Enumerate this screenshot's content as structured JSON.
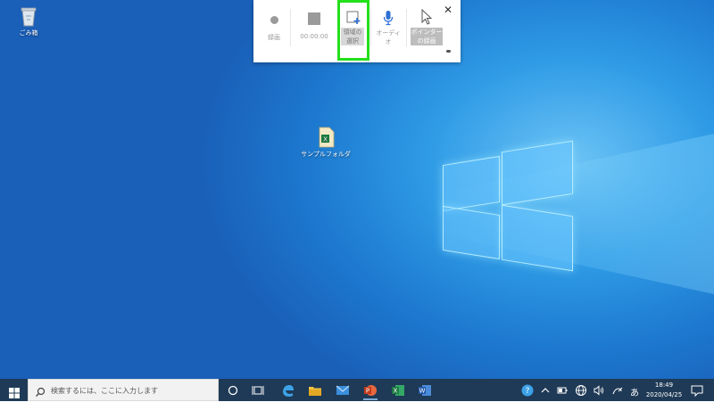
{
  "desktop": {
    "icons": [
      {
        "label": "ごみ箱",
        "name": "recycle-bin"
      },
      {
        "label": "サンプルフォルダ",
        "name": "sample-folder"
      }
    ]
  },
  "toolbar": {
    "record_label": "録画",
    "timer": "00:00:00",
    "select_area_label_1": "領域の",
    "select_area_label_2": "選択",
    "audio_label_1": "オーディ",
    "audio_label_2": "オ",
    "pointer_label_1": "ポインター",
    "pointer_label_2": "の録画"
  },
  "taskbar": {
    "search_placeholder": "検索するには、ここに入力します",
    "ime": "あ",
    "time": "18:49",
    "date": "2020/04/25"
  },
  "colors": {
    "highlight": "#23e01a",
    "taskbar": "#1f3a56"
  }
}
